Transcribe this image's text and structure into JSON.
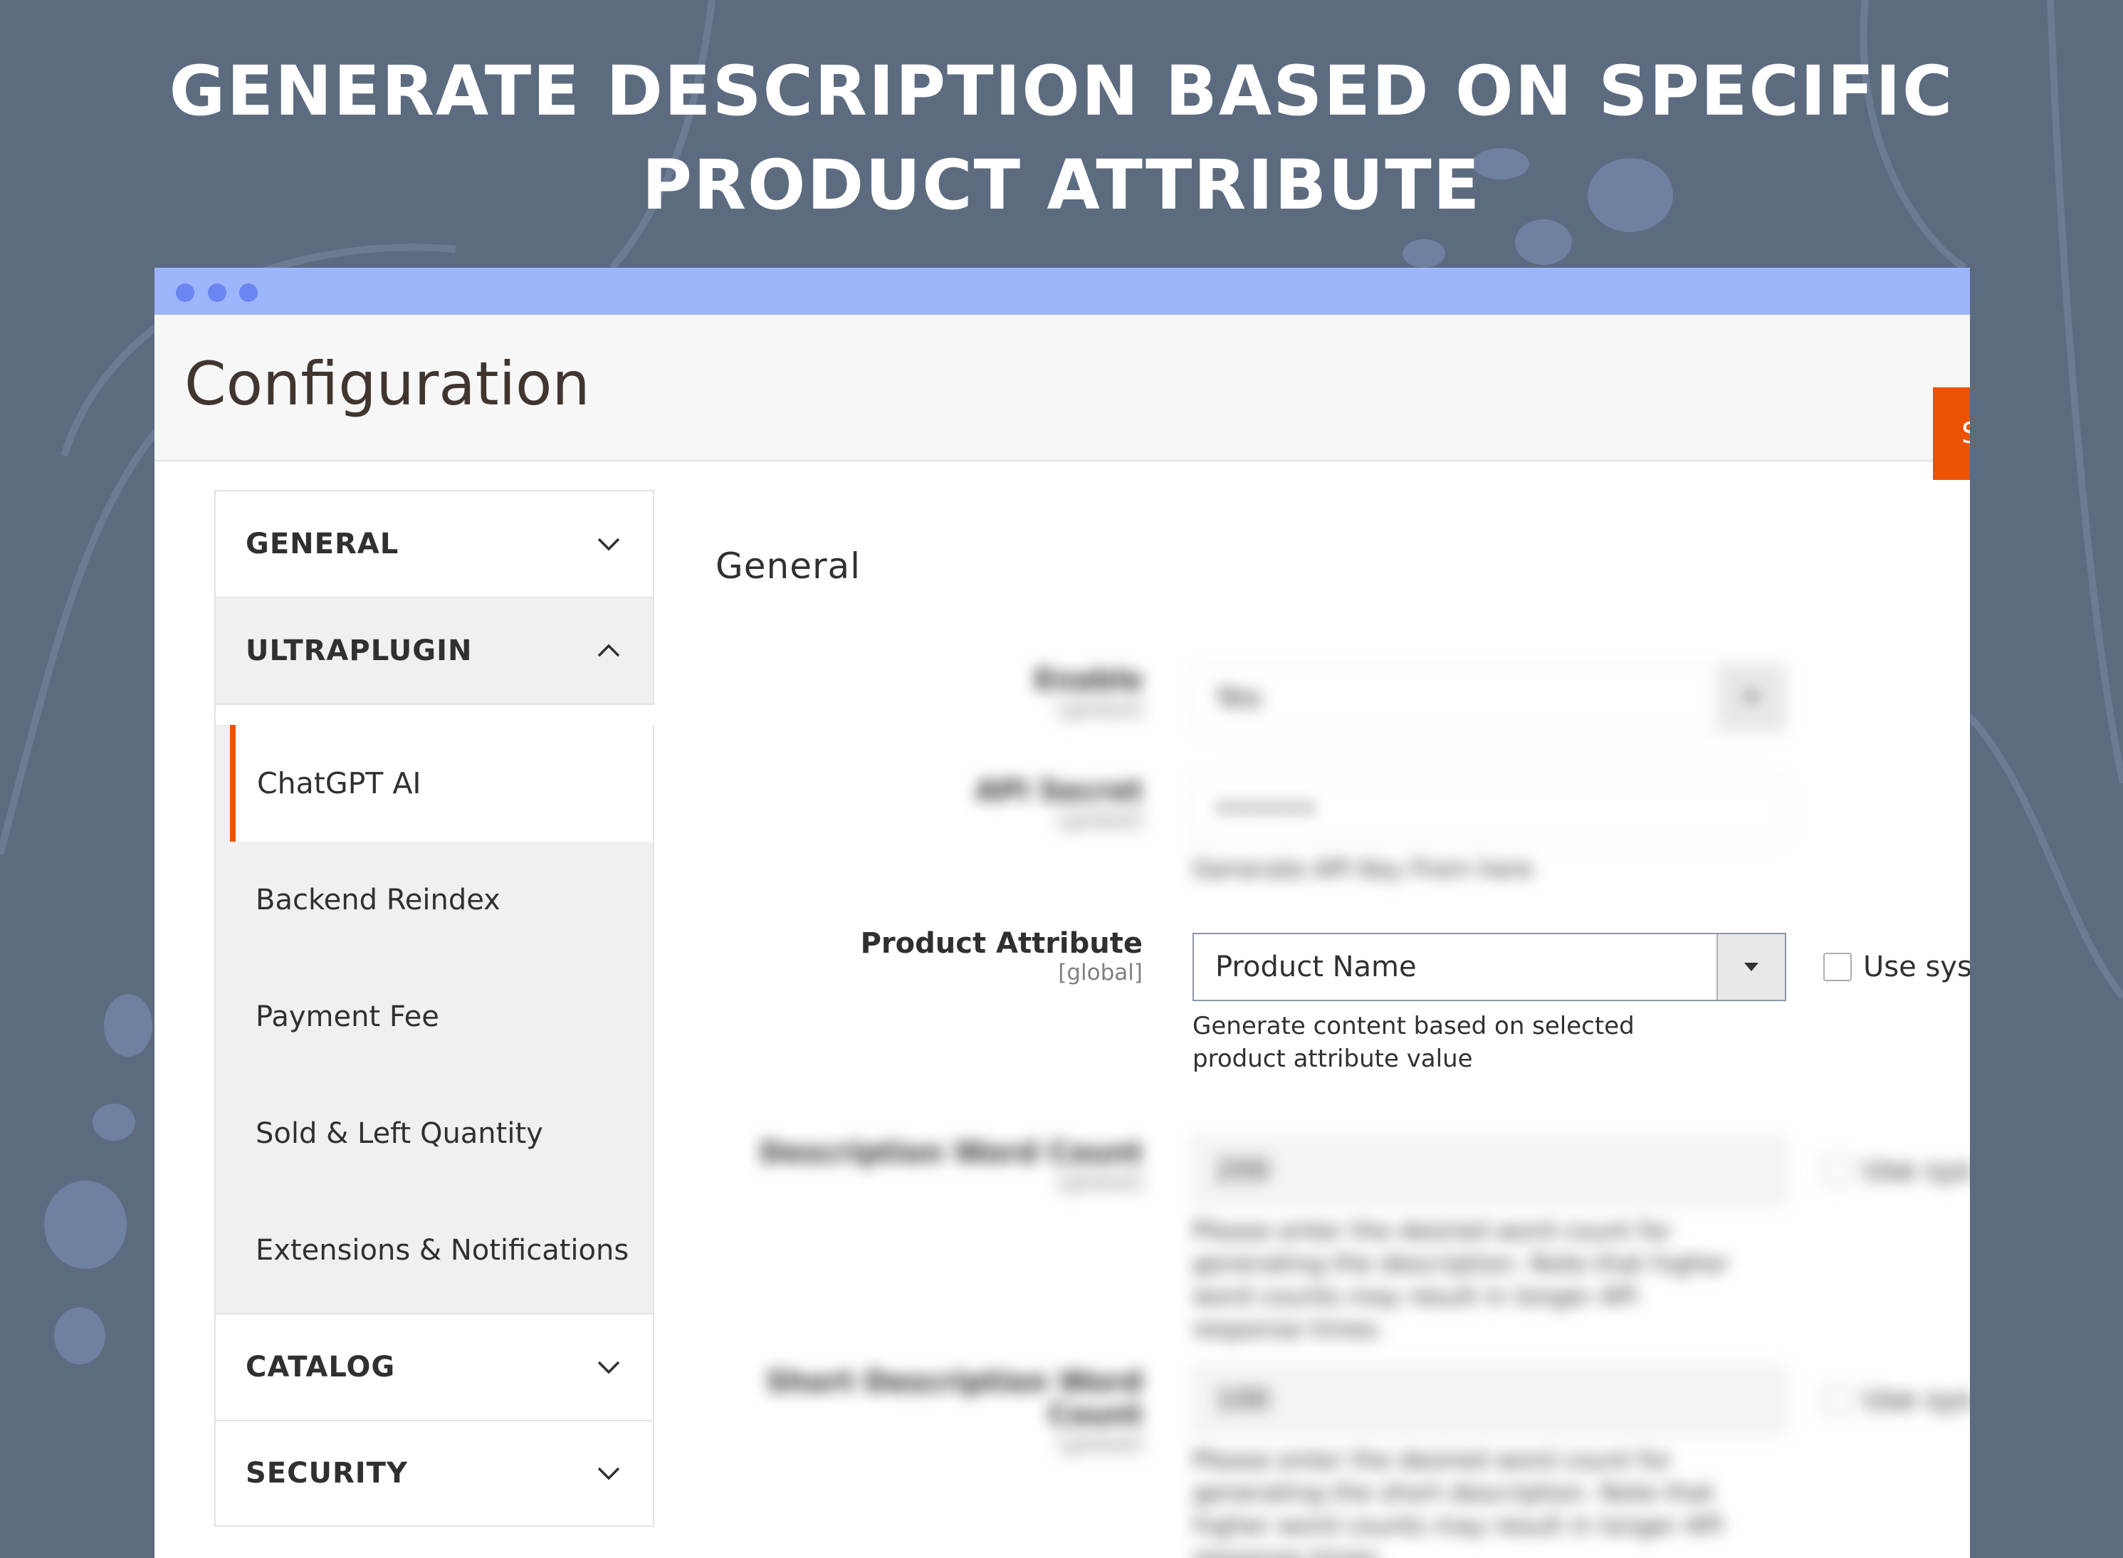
{
  "hero": {
    "line1": "GENERATE DESCRIPTION BASED ON SPECIFIC",
    "line2": "PRODUCT ATTRIBUTE"
  },
  "colors": {
    "background": "#5d6b80",
    "titlebar": "#9cb5fb",
    "accent": "#eb5202"
  },
  "page": {
    "title": "Configuration",
    "save_label": "S"
  },
  "sidebar": {
    "sections": [
      {
        "label": "GENERAL",
        "expanded": false
      },
      {
        "label": "ULTRAPLUGIN",
        "expanded": true
      },
      {
        "label": "CATALOG",
        "expanded": false
      },
      {
        "label": "SECURITY",
        "expanded": false
      }
    ],
    "items": [
      {
        "label": "ChatGPT AI",
        "active": true
      },
      {
        "label": "Backend Reindex",
        "active": false
      },
      {
        "label": "Payment Fee",
        "active": false
      },
      {
        "label": "Sold & Left Quantity",
        "active": false
      },
      {
        "label": "Extensions & Notifications",
        "active": false
      }
    ]
  },
  "main": {
    "section_title": "General",
    "fields": [
      {
        "label": "Enable",
        "scope": "[global]",
        "value": "Yes"
      },
      {
        "label": "API Secret",
        "scope": "[global]",
        "value": "••••••",
        "note": "Generate API Key From here"
      },
      {
        "label": "Product Attribute",
        "scope": "[global]",
        "value": "Product Name",
        "note": "Generate content based on selected product attribute value",
        "checkbox_label": "Use sys"
      },
      {
        "label": "Description Word Count",
        "scope": "[global]",
        "value": "200",
        "note": "Please enter the desired word count for generating the description. Note that higher word counts may result in longer API response times.",
        "checkbox_label": "Use sys"
      },
      {
        "label": "Short Description Word Count",
        "scope": "[global]",
        "value": "100",
        "note": "Please enter the desired word count for generating the short description. Note that higher word counts may result in longer API response times.",
        "checkbox_label": "Use sys"
      }
    ]
  }
}
